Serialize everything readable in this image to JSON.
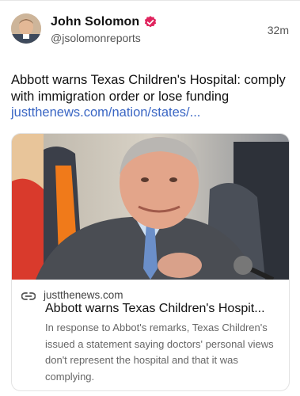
{
  "post": {
    "author_name": "John Solomon",
    "handle": "@jsolomonreports",
    "timestamp": "32m",
    "text": "Abbott warns Texas Children's Hospital: comply with immigration order or lose funding",
    "link_text": "justthenews.com/nation/states/...",
    "verified_color": "#e0245e",
    "link_color": "#3a66c4"
  },
  "card": {
    "domain": "justthenews.com",
    "title": "Abbott warns Texas Children's Hospit...",
    "description": "In response to Abbot's remarks, Texas Children's issued a statement saying doctors' personal views don't represent the hospital and that it was complying.",
    "icon": "link-icon"
  }
}
